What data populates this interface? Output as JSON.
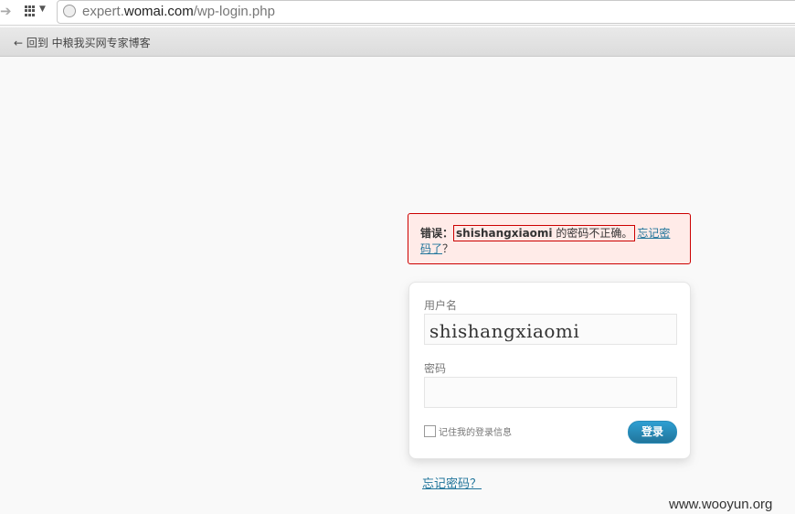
{
  "browser": {
    "url_prefix": "expert.",
    "url_domain": "womai.com",
    "url_path": "/wp-login.php"
  },
  "backbar": {
    "back_link": "← 回到 中粮我买网专家博客"
  },
  "error": {
    "label": "错误：",
    "username": "shishangxiaomi",
    "message": " 的密码不正确。",
    "forgot_link": "忘记密码了",
    "suffix": "？"
  },
  "form": {
    "username_label": "用户名",
    "username_value": "shishangxiaomi",
    "password_label": "密码",
    "password_value": "",
    "remember_label": "记住我的登录信息",
    "submit_label": "登录"
  },
  "footer": {
    "forgot_link": "忘记密码？",
    "watermark": "www.wooyun.org"
  }
}
